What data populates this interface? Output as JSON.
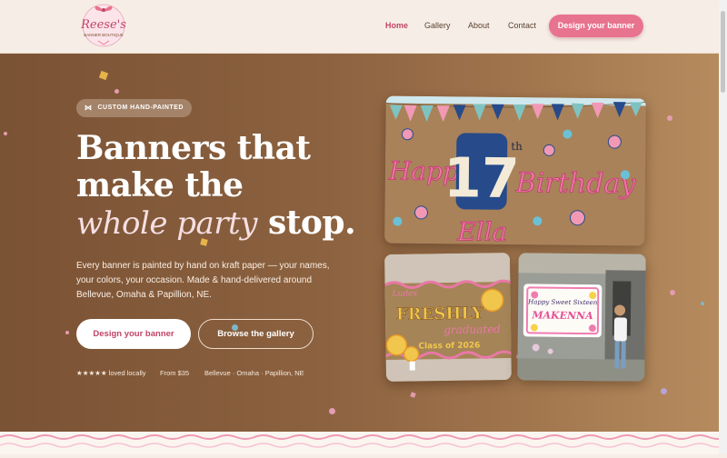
{
  "brand": {
    "name": "Reese's",
    "sub": "BANNER BOUTIQUE"
  },
  "nav": {
    "items": [
      "Home",
      "Gallery",
      "About",
      "Contact"
    ],
    "cta": "Design your banner"
  },
  "hero": {
    "badge": "CUSTOM HAND-PAINTED",
    "headline_1": "Banners that",
    "headline_2": "make the",
    "headline_script": "whole party",
    "headline_end": "stop.",
    "lead": "Every banner is painted by hand on kraft paper — your names, your colors, your occasion. Made & hand-delivered around Bellevue, Omaha & Papillion, NE.",
    "primary_cta": "Design your banner",
    "secondary_cta": "Browse the gallery",
    "meta": [
      "★★★★★ loved locally",
      "From $35",
      "Bellevue · Omaha · Papillion, NE"
    ]
  },
  "photos": {
    "birthday": {
      "line1": "Happy",
      "number": "17",
      "suffix": "th",
      "line2": "Birthday",
      "name": "Ella"
    },
    "grad": {
      "line1": "Ludes",
      "line2": "FRESHLY",
      "line3": "graduated",
      "line4": "Class of 2026"
    },
    "sixteen": {
      "line1": "Happy Sweet Sixteen",
      "line2": "MAKENNA"
    }
  },
  "colors": {
    "accent": "#e8738f",
    "hero_dark": "#7a5234",
    "hero_light": "#b68c5f",
    "cream": "#f6eee6"
  }
}
